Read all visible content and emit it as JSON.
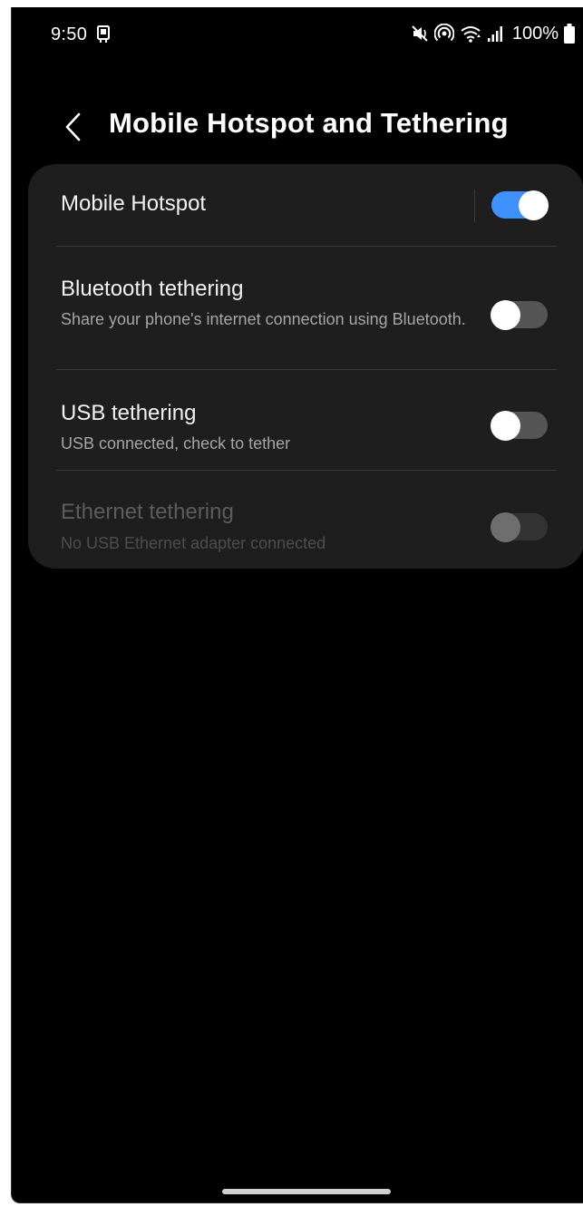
{
  "status_bar": {
    "time": "9:50",
    "battery": "100%",
    "icons": [
      "screenshot-icon",
      "mute-icon",
      "hotspot-icon",
      "wifi-icon",
      "signal-icon",
      "battery-icon"
    ]
  },
  "header": {
    "back_icon": "back-chevron-icon",
    "title": "Mobile Hotspot and Tethering"
  },
  "settings": [
    {
      "title": "Mobile Hotspot",
      "subtitle": "",
      "state": "on",
      "enabled": true
    },
    {
      "title": "Bluetooth tethering",
      "subtitle": "Share your phone's internet connection using Bluetooth.",
      "state": "off",
      "enabled": true
    },
    {
      "title": "USB tethering",
      "subtitle": "USB connected, check to tether",
      "state": "off",
      "enabled": true
    },
    {
      "title": "Ethernet tethering",
      "subtitle": "No USB Ethernet adapter connected",
      "state": "off",
      "enabled": false
    }
  ],
  "colors": {
    "background": "#000000",
    "card": "#1e1e1e",
    "accent": "#3e91ff",
    "toggle_off": "#555555"
  }
}
